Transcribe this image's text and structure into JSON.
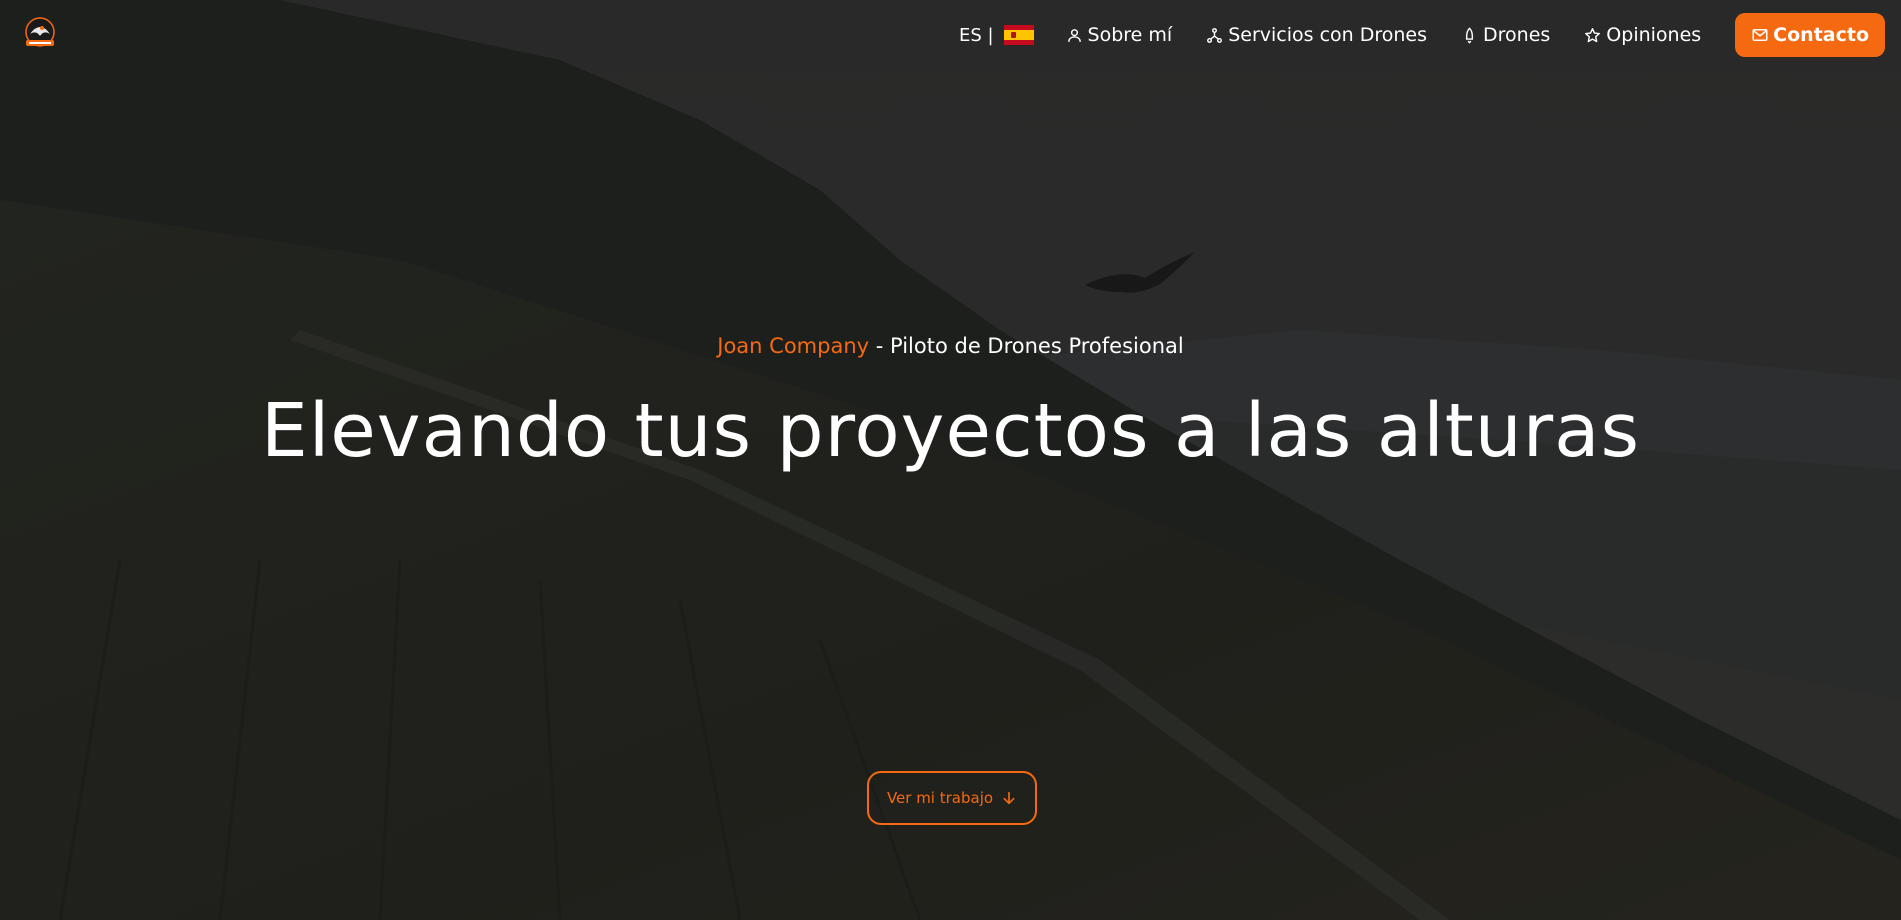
{
  "nav": {
    "language_code": "ES |",
    "links": [
      {
        "label": "Sobre mí",
        "icon": "user-icon"
      },
      {
        "label": "Servicios con Drones",
        "icon": "drone-network-icon"
      },
      {
        "label": "Drones",
        "icon": "rocket-icon"
      },
      {
        "label": "Opiniones",
        "icon": "star-icon"
      }
    ],
    "contact_label": "Contacto",
    "contact_icon": "mail-icon"
  },
  "hero": {
    "name": "Joan Company",
    "role": " - Piloto de Drones Profesional",
    "headline": "Elevando tus proyectos a las alturas",
    "cta_label": "Ver mi trabajo",
    "cta_icon": "arrow-down-icon"
  },
  "colors": {
    "accent": "#f56a11",
    "text": "#ffffff",
    "background": "#2b2b2b"
  }
}
